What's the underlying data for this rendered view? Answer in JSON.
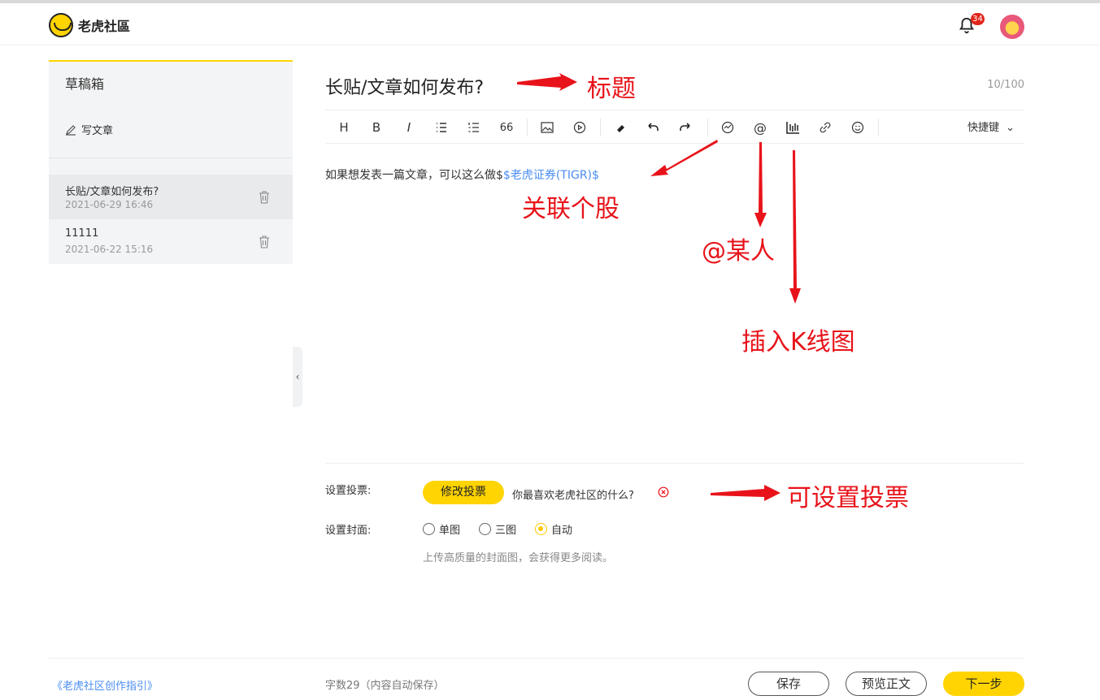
{
  "header": {
    "logo_text": "老虎社區",
    "notification_count": "34"
  },
  "sidebar": {
    "title": "草稿箱",
    "write_label": "写文章",
    "drafts": [
      {
        "title": "长贴/文章如何发布?",
        "date": "2021-06-29 16:46"
      },
      {
        "title": "11111",
        "date": "2021-06-22 15:16"
      }
    ]
  },
  "editor": {
    "title": "长贴/文章如何发布?",
    "title_count": "10/100",
    "shortcut_label": "快捷键",
    "body_text": "如果想发表一篇文章，可以这么做$",
    "body_stock": "$老虎证券(TIGR)$",
    "toolbar": {
      "heading": "H",
      "bold": "B",
      "italic": "I",
      "quote": "66"
    }
  },
  "annotations": {
    "title": "标题",
    "stock": "关联个股",
    "mention": "@某人",
    "kline": "插入K线图",
    "vote": "可设置投票"
  },
  "settings": {
    "vote_label": "设置投票:",
    "vote_button": "修改投票",
    "vote_question": "你最喜欢老虎社区的什么?",
    "cover_label": "设置封面:",
    "cover_options": [
      "单图",
      "三图",
      "自动"
    ],
    "cover_selected": "自动",
    "cover_hint": "上传高质量的封面图，会获得更多阅读。"
  },
  "footer": {
    "guide_link": "《老虎社区创作指引》",
    "word_count": "字数29（内容自动保存）",
    "save": "保存",
    "preview": "预览正文",
    "next": "下一步"
  },
  "colors": {
    "accent": "#ffd400",
    "link": "#4a8df0",
    "annotation": "#e8131a"
  }
}
